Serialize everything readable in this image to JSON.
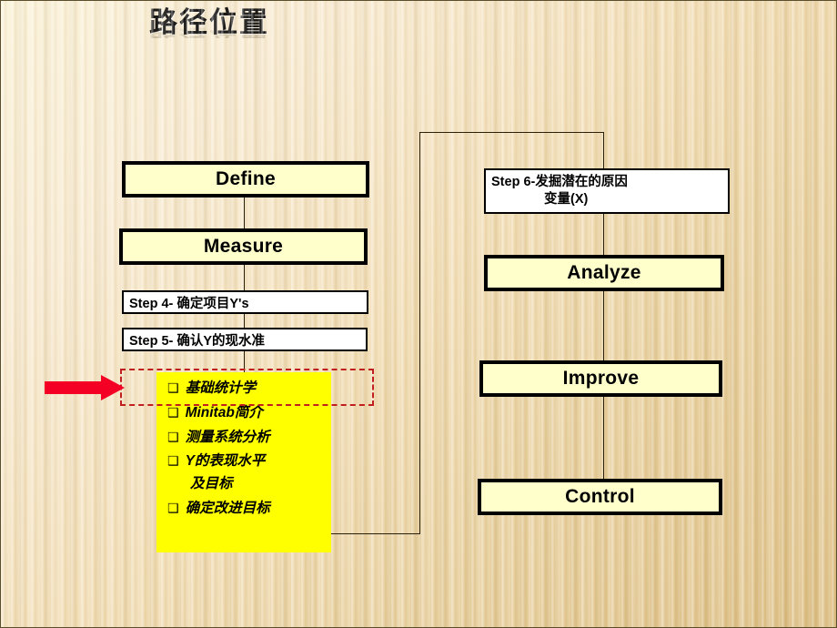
{
  "slide": {
    "title": "路径位置",
    "background_top_color": "#fbf2d8",
    "background_bottom_color": "#ddbe82"
  },
  "colors": {
    "phase_box_fill": "#ffffcc",
    "step_box_fill": "#ffffff",
    "topic_block_fill": "#ffff00",
    "highlight_dash": "#c11e1e",
    "arrow": "#f40024",
    "border": "#000000"
  },
  "left_column": {
    "phases": [
      {
        "label": "Define"
      },
      {
        "label": "Measure"
      }
    ],
    "steps": [
      {
        "label": "Step 4- 确定项目Y's"
      },
      {
        "label": "Step 5- 确认Y的现水准"
      }
    ],
    "topics": [
      {
        "bullet": "❑",
        "label": "基础统计学",
        "highlighted": true
      },
      {
        "bullet": "❑",
        "label": "Minitab简介",
        "highlighted": false
      },
      {
        "bullet": "❑",
        "label": "测量系统分析",
        "highlighted": false
      },
      {
        "bullet": "❑",
        "label": "Y的表现水平",
        "highlighted": false
      },
      {
        "bullet": "",
        "label": "及目标",
        "highlighted": false
      },
      {
        "bullet": "❑",
        "label": "确定改进目标",
        "highlighted": false
      }
    ]
  },
  "right_column": {
    "step6": {
      "line1": "Step 6-发掘潜在的原因",
      "line2": "变量(X)"
    },
    "phases": [
      {
        "label": "Analyze"
      },
      {
        "label": "Improve"
      },
      {
        "label": "Control"
      }
    ]
  }
}
